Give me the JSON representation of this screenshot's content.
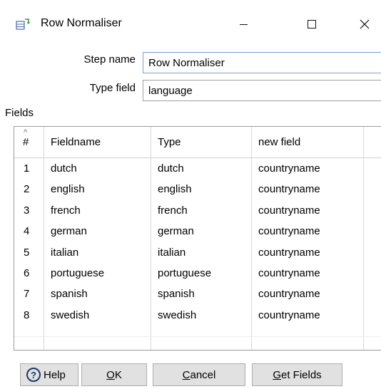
{
  "window": {
    "title": "Row Normaliser",
    "icon": "row-normaliser-icon",
    "controls": [
      "minimize-icon",
      "maximize-icon",
      "close-icon"
    ]
  },
  "form": {
    "step_name_label": "Step name",
    "step_name_value": "Row Normaliser",
    "type_field_label": "Type field",
    "type_field_value": "language",
    "fields_label": "Fields"
  },
  "table": {
    "headers": [
      "#",
      "Fieldname",
      "Type",
      "new field"
    ],
    "rows": [
      {
        "num": "1",
        "fieldname": "dutch",
        "type": "dutch",
        "newfield": "countryname"
      },
      {
        "num": "2",
        "fieldname": "english",
        "type": "english",
        "newfield": "countryname"
      },
      {
        "num": "3",
        "fieldname": "french",
        "type": "french",
        "newfield": "countryname"
      },
      {
        "num": "4",
        "fieldname": "german",
        "type": "german",
        "newfield": "countryname"
      },
      {
        "num": "5",
        "fieldname": "italian",
        "type": "italian",
        "newfield": "countryname"
      },
      {
        "num": "6",
        "fieldname": "portuguese",
        "type": "portuguese",
        "newfield": "countryname"
      },
      {
        "num": "7",
        "fieldname": "spanish",
        "type": "spanish",
        "newfield": "countryname"
      },
      {
        "num": "8",
        "fieldname": "swedish",
        "type": "swedish",
        "newfield": "countryname"
      }
    ]
  },
  "buttons": {
    "help": "Help",
    "ok_mnemonic": "O",
    "ok_rest": "K",
    "cancel_mnemonic": "C",
    "cancel_rest": "ancel",
    "getfields_mnemonic": "G",
    "getfields_rest": "et Fields"
  }
}
